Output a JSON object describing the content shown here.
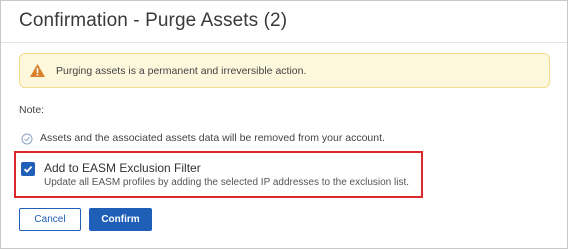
{
  "dialog": {
    "title": "Confirmation - Purge Assets (2)",
    "warning": {
      "icon": "warning-triangle-icon",
      "text": "Purging assets is a permanent and irreversible action."
    },
    "note_label": "Note:",
    "info": {
      "icon": "check-circle-icon",
      "text": "Assets and the associated assets data will be removed from your account."
    },
    "exclusion_filter": {
      "checked": true,
      "title": "Add to EASM Exclusion Filter",
      "description": "Update all EASM profiles by adding the selected IP addresses to the exclusion list."
    },
    "buttons": {
      "cancel_label": "Cancel",
      "confirm_label": "Confirm"
    }
  },
  "colors": {
    "accent": "#1f5fb8",
    "warning_bg": "#fdf7dc",
    "warning_icon": "#d9822b",
    "highlight_border": "#d9292c"
  }
}
